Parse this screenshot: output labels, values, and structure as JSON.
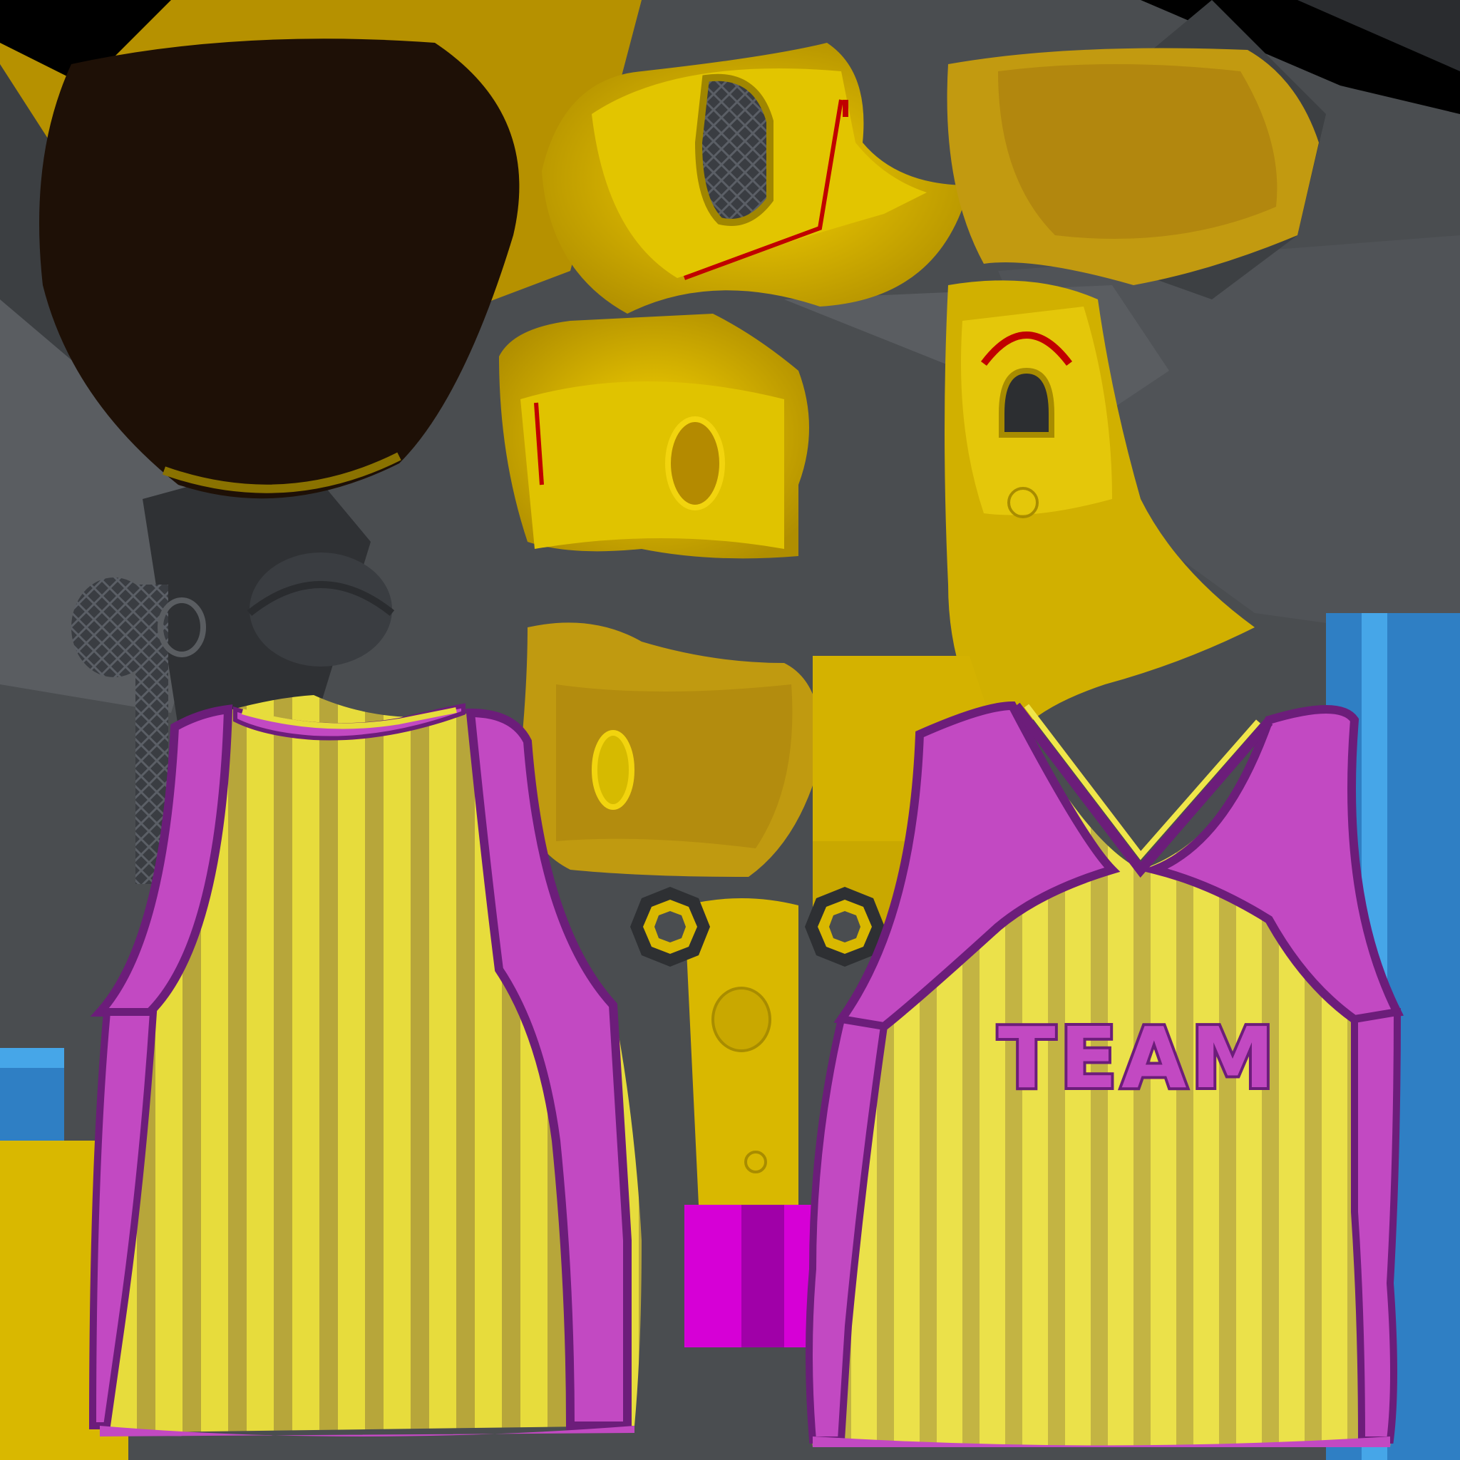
{
  "texture": {
    "front_jersey_text": "TEAM"
  },
  "colors": {
    "gold": "#d9b800",
    "gold_light": "#f2d40e",
    "gold_dark": "#a88c00",
    "ochre": "#c29a10",
    "gray": "#4a4d50",
    "gray_light": "#6a6d70",
    "gray_dark": "#2e3033",
    "hair": "#1e1006",
    "jersey_base": "#e7dc3c",
    "jersey_stripe": "#b7a63a",
    "trim_magenta": "#c249c2",
    "trim_purple": "#6c1d7a",
    "red_accent": "#c00000",
    "blue": "#2f7fc4",
    "blue_light": "#46a6e8",
    "green": "#1cc63c",
    "magenta": "#d600d6"
  },
  "icons": [
    "stitch-ring-icon",
    "mesh-vent-icon"
  ]
}
